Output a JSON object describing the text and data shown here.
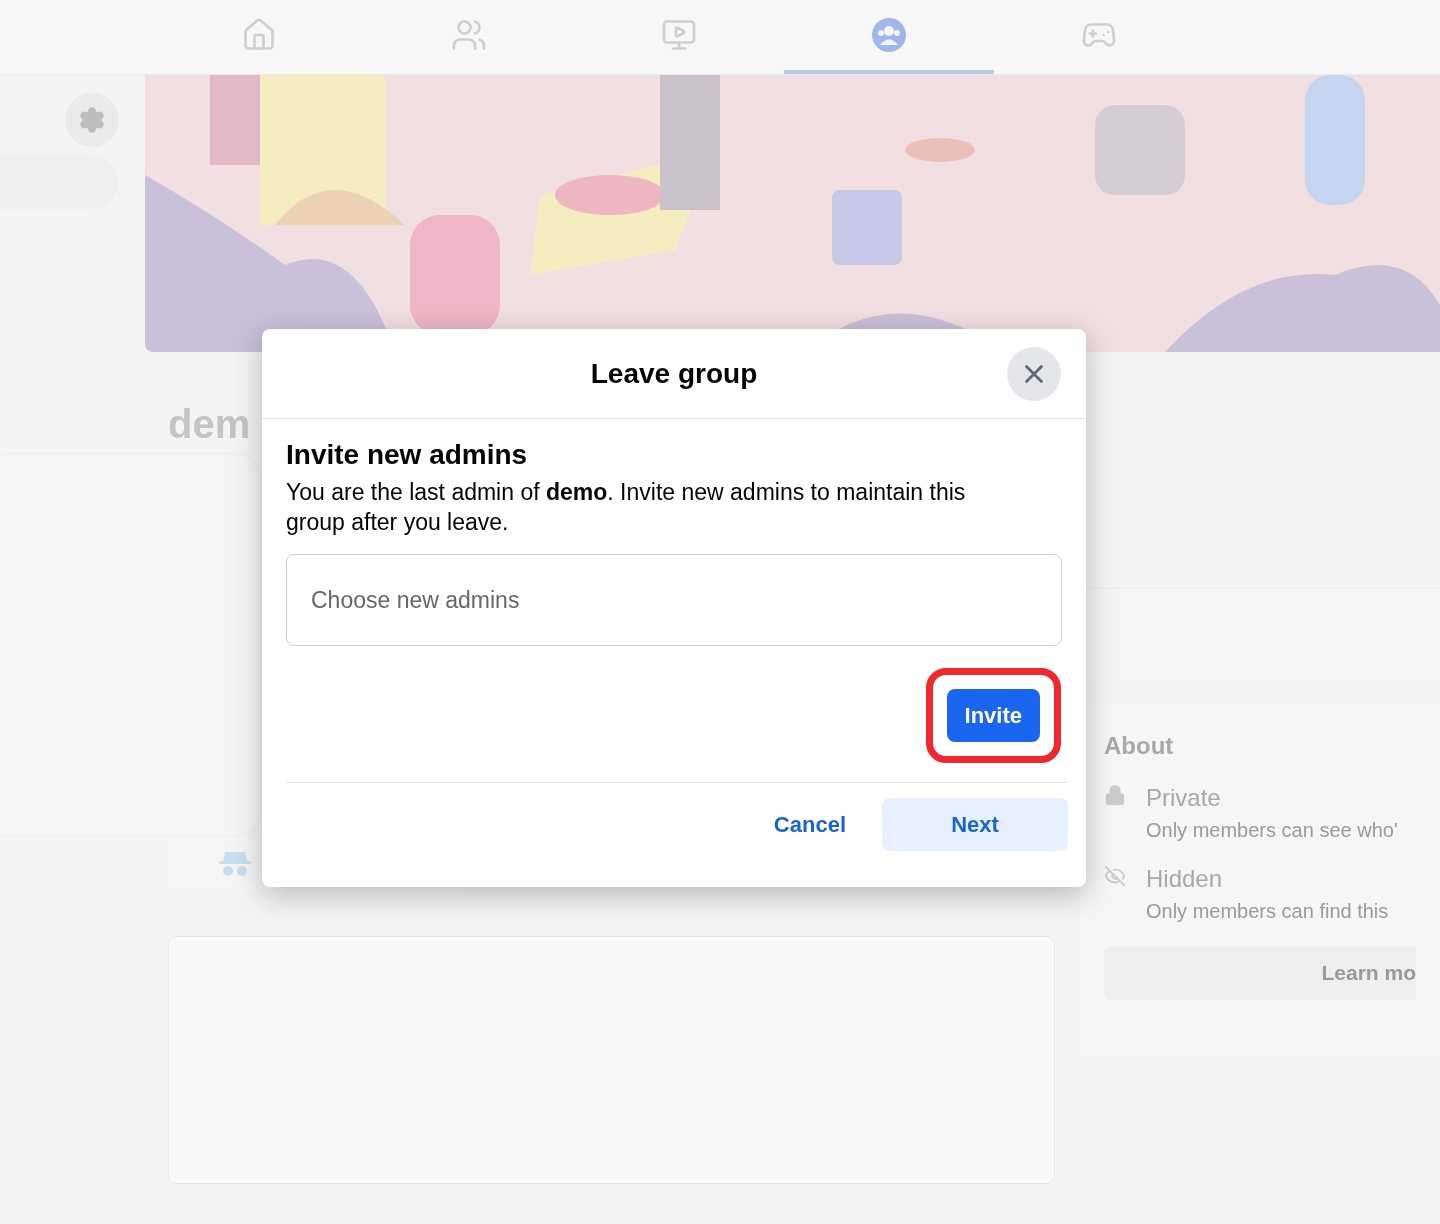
{
  "nav": {
    "tabs": [
      {
        "kind": "home",
        "selected": false
      },
      {
        "kind": "friends",
        "selected": false
      },
      {
        "kind": "watch",
        "selected": false
      },
      {
        "kind": "groups",
        "selected": true
      },
      {
        "kind": "gaming",
        "selected": false
      }
    ]
  },
  "group": {
    "name": "dem"
  },
  "about": {
    "title": "About",
    "items": [
      {
        "kind": "lock",
        "title": "Private",
        "description": "Only members can see who'"
      },
      {
        "kind": "eye",
        "title": "Hidden",
        "description": "Only members can find this"
      }
    ],
    "button": "Learn mo"
  },
  "dialog": {
    "title": "Leave group",
    "heading": "Invite new admins",
    "message": "You are the last admin of **demo**. Invite new admins to maintain this group after you leave.",
    "field": {
      "placeholder": "Choose new admins"
    },
    "invite_button": {
      "label": "Invite",
      "highlighted": true
    },
    "buttons": [
      {
        "label": "Cancel",
        "kind": "text"
      },
      {
        "label": "Next",
        "kind": "soft"
      }
    ]
  }
}
